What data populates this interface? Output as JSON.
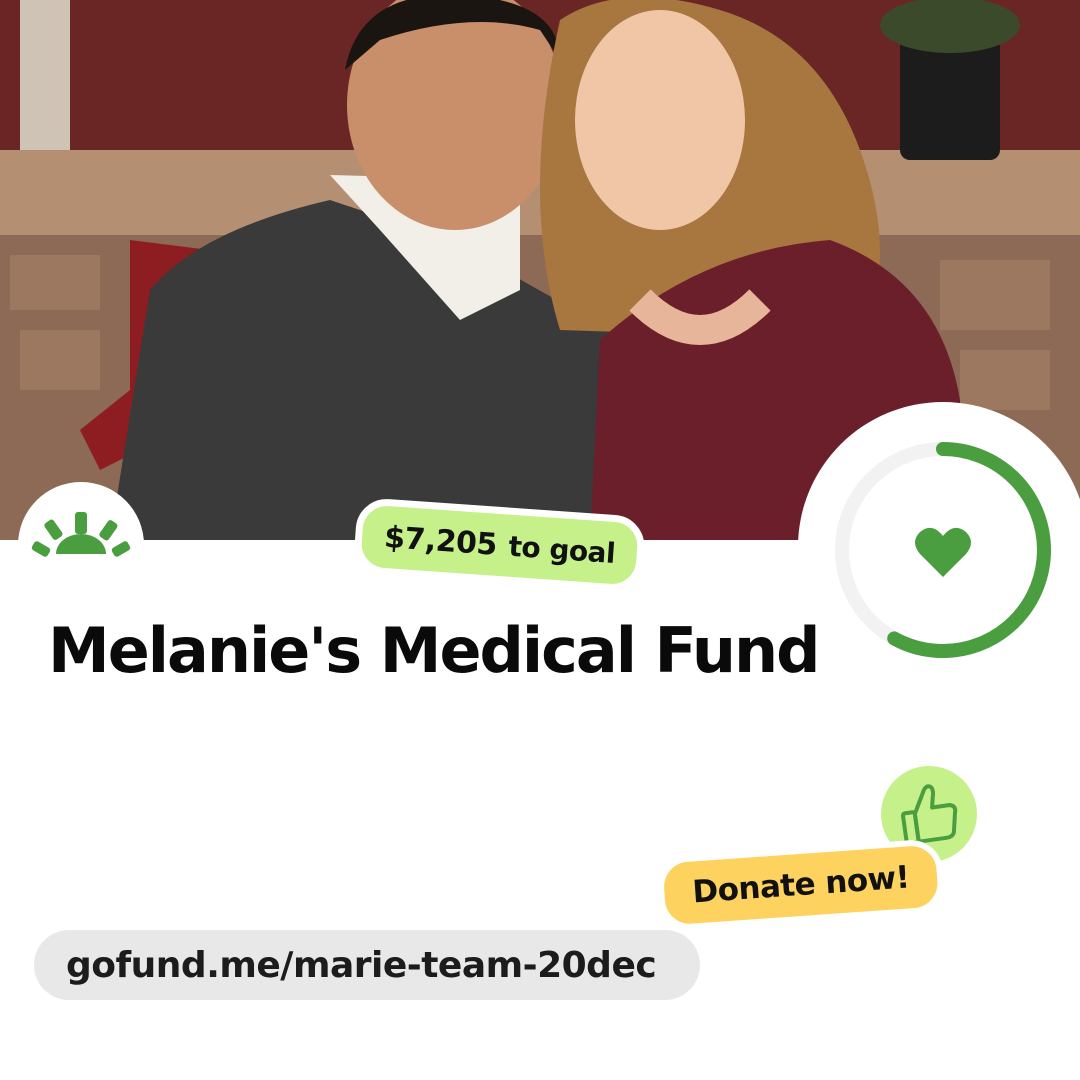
{
  "campaign": {
    "title": "Melanie's Medical Fund",
    "goal_amount": "$7,205",
    "goal_label": "to goal",
    "progress_fraction": 0.58,
    "donate_label": "Donate now!",
    "url": "gofund.me/marie-team-20dec"
  },
  "icons": {
    "logo": "gofundme-sun-logo",
    "ring_center": "heart-icon",
    "thumb": "thumbs-up-icon"
  },
  "colors": {
    "brand_green": "#4a9e3f",
    "ring_track": "#f2f2f2",
    "goal_pill": "#c6f08a",
    "donate_pill": "#fdd25f",
    "url_pill": "#e8e8e8",
    "thumb_bg": "#c6f08a"
  }
}
